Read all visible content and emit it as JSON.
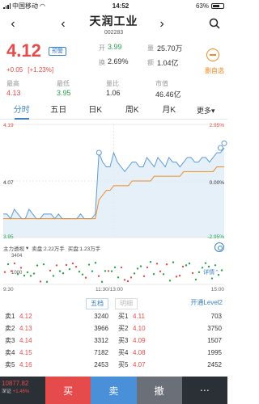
{
  "status": {
    "carrier": "中国移动",
    "time": "14:52",
    "battery": "63%",
    "battery_level": 0.63
  },
  "header": {
    "name": "天润工业",
    "code": "002283"
  },
  "quote": {
    "price": "4.12",
    "badge": "预警",
    "change": "+0.05",
    "change_pct": "[+1.23%]",
    "open_label": "开",
    "open": "3.99",
    "volume_label": "量",
    "volume": "25.70万",
    "turnover_label": "换",
    "turnover": "2.69%",
    "amount_label": "额",
    "amount": "1.04亿",
    "high_label": "最高",
    "high": "4.13",
    "low_label": "最低",
    "low": "3.95",
    "ratio_label": "量比",
    "ratio": "1.06",
    "mcap_label": "市值",
    "mcap": "46.46亿",
    "delete_label": "删自选"
  },
  "tabs": [
    "分时",
    "五日",
    "日K",
    "周K",
    "月K",
    "更多"
  ],
  "chart": {
    "price_hi": "4.19",
    "price_mid": "4.07",
    "price_lo": "3.95",
    "pct_hi": "2.95%",
    "pct_mid": "0.00%",
    "pct_lo": "-2.95%"
  },
  "chart_data": {
    "type": "line",
    "x": [
      0,
      4,
      8,
      12,
      16,
      20,
      24,
      28,
      32,
      36,
      40,
      44,
      48,
      52,
      56,
      60,
      64,
      68,
      72,
      76,
      80,
      84,
      88,
      92,
      96,
      100,
      104,
      108,
      112,
      116,
      120,
      124,
      128,
      132,
      136,
      140,
      144,
      148,
      152,
      156,
      160,
      164,
      168,
      172,
      176,
      180,
      184,
      188,
      192,
      196,
      200,
      204,
      208,
      212,
      216,
      220,
      224,
      228,
      232,
      236,
      240
    ],
    "series": [
      {
        "values": [
          4.0,
          4.0,
          3.99,
          4.01,
          4.0,
          3.99,
          3.99,
          4.01,
          4.0,
          3.99,
          3.99,
          4.0,
          4.0,
          4.0,
          3.99,
          4.0,
          3.99,
          3.99,
          3.99,
          3.99,
          3.99,
          4.0,
          3.99,
          3.99,
          3.99,
          4.0,
          4.13,
          4.11,
          4.1,
          4.1,
          4.13,
          4.11,
          4.1,
          4.09,
          4.1,
          4.11,
          4.11,
          4.1,
          4.1,
          4.12,
          4.11,
          4.1,
          4.12,
          4.11,
          4.1,
          4.12,
          4.11,
          4.11,
          4.1,
          4.11,
          4.12,
          4.12,
          4.11,
          4.11,
          4.12,
          4.12,
          4.11,
          4.12,
          4.13,
          4.13,
          4.14
        ],
        "color": "#5b9bd5"
      },
      {
        "values": [
          3.99,
          3.99,
          3.99,
          3.99,
          3.99,
          3.99,
          3.99,
          3.99,
          3.99,
          3.99,
          3.99,
          3.99,
          3.99,
          3.99,
          3.99,
          3.99,
          3.99,
          3.99,
          3.99,
          3.99,
          3.99,
          3.99,
          3.99,
          3.99,
          3.99,
          3.99,
          4.03,
          4.04,
          4.05,
          4.05,
          4.06,
          4.06,
          4.06,
          4.06,
          4.06,
          4.07,
          4.07,
          4.07,
          4.07,
          4.07,
          4.07,
          4.08,
          4.08,
          4.08,
          4.08,
          4.08,
          4.08,
          4.08,
          4.08,
          4.09,
          4.09,
          4.09,
          4.09,
          4.09,
          4.09,
          4.09,
          4.09,
          4.09,
          4.1,
          4.1,
          4.1
        ],
        "color": "#f08a24"
      }
    ],
    "ylim": [
      3.95,
      4.19
    ]
  },
  "indicator": {
    "name": "主力透视",
    "main_sell": "卖盘:2.22万手",
    "main_buy": "买盘:1.23万手"
  },
  "volume": {
    "top": "3404",
    "mid": "1000",
    "detail": "详情"
  },
  "time_axis": [
    "9:30",
    "11:30/13:00",
    "15:00"
  ],
  "book_tabs": {
    "five": "五档",
    "detail": "明细",
    "level2": "开通Level2"
  },
  "book": {
    "sell_left": [
      {
        "label": "卖1",
        "price": "4.12",
        "vol": "3240"
      },
      {
        "label": "卖2",
        "price": "4.13",
        "vol": "3966"
      },
      {
        "label": "卖3",
        "price": "4.14",
        "vol": "3312"
      },
      {
        "label": "卖4",
        "price": "4.15",
        "vol": "7182"
      },
      {
        "label": "卖5",
        "price": "4.16",
        "vol": "2453"
      }
    ],
    "buy_right": [
      {
        "label": "买1",
        "price": "4.11",
        "vol": "703"
      },
      {
        "label": "买2",
        "price": "4.10",
        "vol": "3750"
      },
      {
        "label": "买3",
        "price": "4.09",
        "vol": "1507"
      },
      {
        "label": "买4",
        "price": "4.08",
        "vol": "1995"
      },
      {
        "label": "买5",
        "price": "4.07",
        "vol": "2452"
      }
    ]
  },
  "bottom": {
    "index": "10877.82",
    "index_label": "深证",
    "index_chg": "+1.46%",
    "buy": "买",
    "sell": "卖",
    "cancel": "撤",
    "more": "⋯"
  }
}
